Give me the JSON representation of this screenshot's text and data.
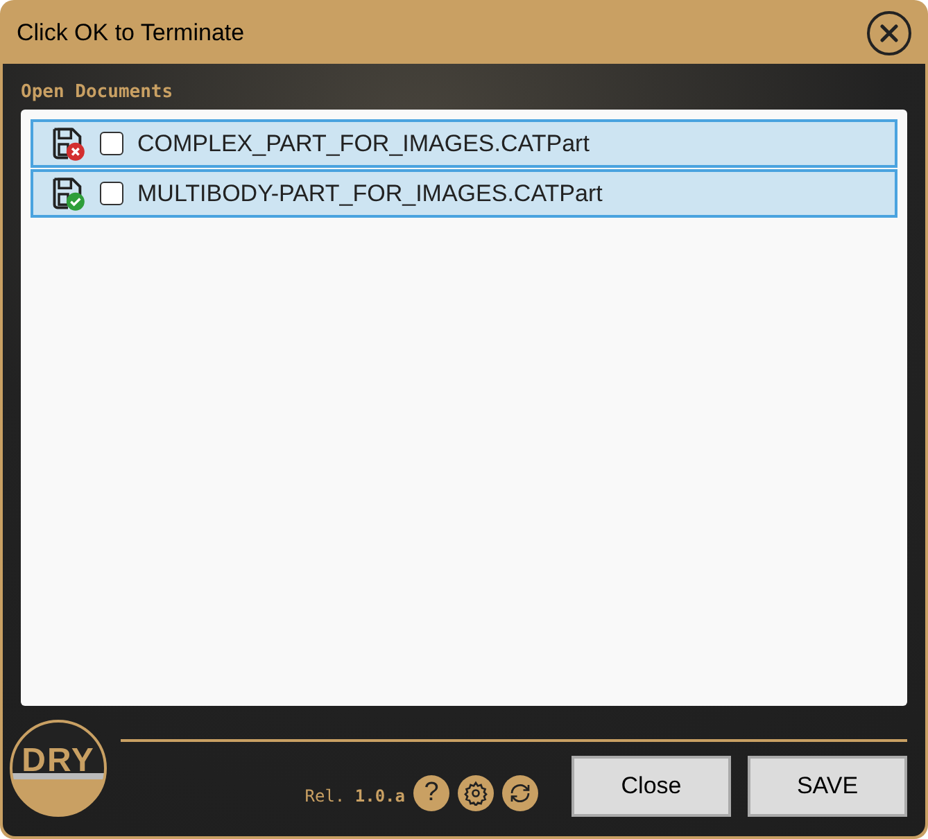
{
  "window": {
    "title": "Click OK to Terminate"
  },
  "section_label": "Open Documents",
  "documents": [
    {
      "name": "COMPLEX_PART_FOR_IMAGES.CATPart",
      "kind": "unsaved",
      "checked": false
    },
    {
      "name": "MULTIBODY-PART_FOR_IMAGES.CATPart",
      "kind": "saved",
      "checked": false
    }
  ],
  "logo": "DRY",
  "release": "Rel. **1.0.a**",
  "help_icon": "?",
  "buttons": [
    "Close",
    "SAVE"
  ]
}
